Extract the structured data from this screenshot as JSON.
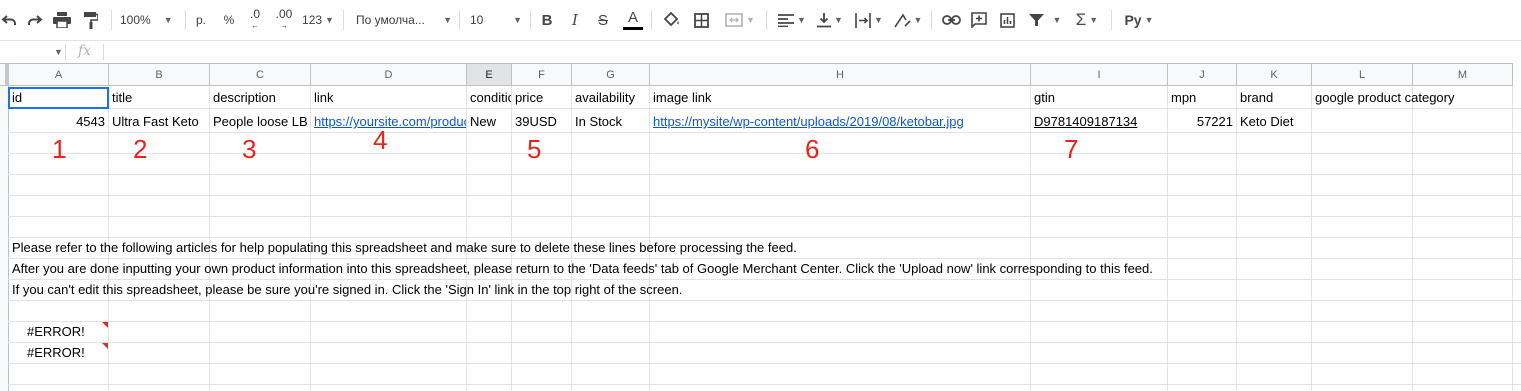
{
  "toolbar": {
    "zoom": "100%",
    "currency": "р.",
    "percent": "%",
    "decrease_decimals": ".0",
    "increase_decimals": ".00",
    "more_formats": "123",
    "font": "По умолча...",
    "font_size": "10",
    "bold": "B",
    "italic": "I",
    "strikethrough": "S",
    "text_color": "A",
    "input_tools": "Pу"
  },
  "formula_bar": {
    "fx": "fx"
  },
  "columns": [
    "A",
    "B",
    "C",
    "D",
    "E",
    "F",
    "G",
    "H",
    "I",
    "J",
    "K",
    "L",
    "M"
  ],
  "rows": {
    "header": {
      "A": "id",
      "B": "title",
      "C": "description",
      "D": "link",
      "E": "condition",
      "F": "price",
      "G": "availability",
      "H": "image link",
      "I": "gtin",
      "J": "mpn",
      "K": "brand",
      "L": "google product category"
    },
    "product": {
      "A": "4543",
      "B": "Ultra Fast Keto",
      "C": "People loose LB",
      "D": "https://yoursite.com/product",
      "E": "New",
      "F": "39USD",
      "G": "In Stock",
      "H": "https://mysite/wp-content/uploads/2019/08/ketobar.jpg",
      "I": "D9781409187134",
      "J": "57221",
      "K": "Keto Diet"
    },
    "notes": [
      "Please refer to the following articles for help populating this spreadsheet and make sure to delete these lines before processing the feed.",
      "After you are done inputting your own product information into this spreadsheet, please return to the 'Data feeds' tab of Google Merchant Center. Click the 'Upload now' link corresponding to this feed.",
      "If you can't edit this spreadsheet, please be sure you're signed in. Click the 'Sign In' link in the top right of the screen."
    ],
    "errors": [
      "#ERROR!",
      "#ERROR!"
    ]
  },
  "annotations": [
    "1",
    "2",
    "3",
    "4",
    "5",
    "6",
    "7"
  ],
  "colors": {
    "link": "#1155cc",
    "annotation": "#e8251d",
    "selection": "#1a73e8",
    "error_marker": "#d93025"
  }
}
